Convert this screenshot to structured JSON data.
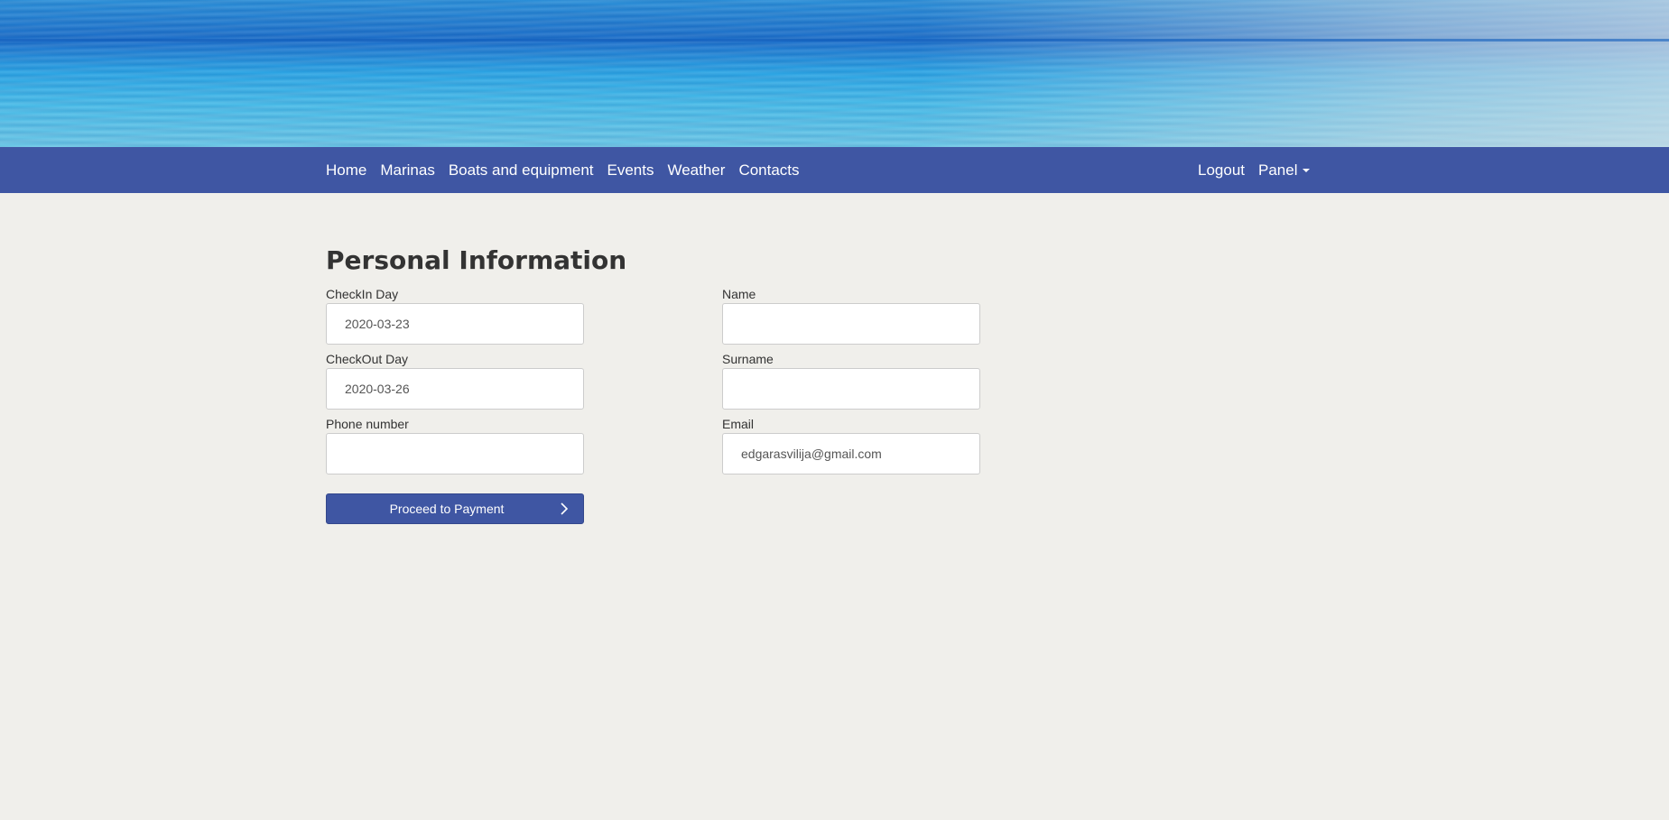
{
  "nav": {
    "left_links": [
      "Home",
      "Marinas",
      "Boats and equipment",
      "Events",
      "Weather",
      "Contacts"
    ],
    "logout": "Logout",
    "panel": "Panel"
  },
  "colors": {
    "nav_bg": "#3f56a3",
    "page_bg": "#f0efeb",
    "button_bg": "#3f56a3"
  },
  "form": {
    "title": "Personal Information",
    "checkin": {
      "label": "CheckIn Day",
      "value": "2020-03-23"
    },
    "checkout": {
      "label": "CheckOut Day",
      "value": "2020-03-26"
    },
    "phone": {
      "label": "Phone number",
      "value": ""
    },
    "name": {
      "label": "Name",
      "value": ""
    },
    "surname": {
      "label": "Surname",
      "value": ""
    },
    "email": {
      "label": "Email",
      "value": "edgarasvilija@gmail.com"
    },
    "submit_label": "Proceed to Payment",
    "submit_icon": "chevron-right-icon"
  }
}
